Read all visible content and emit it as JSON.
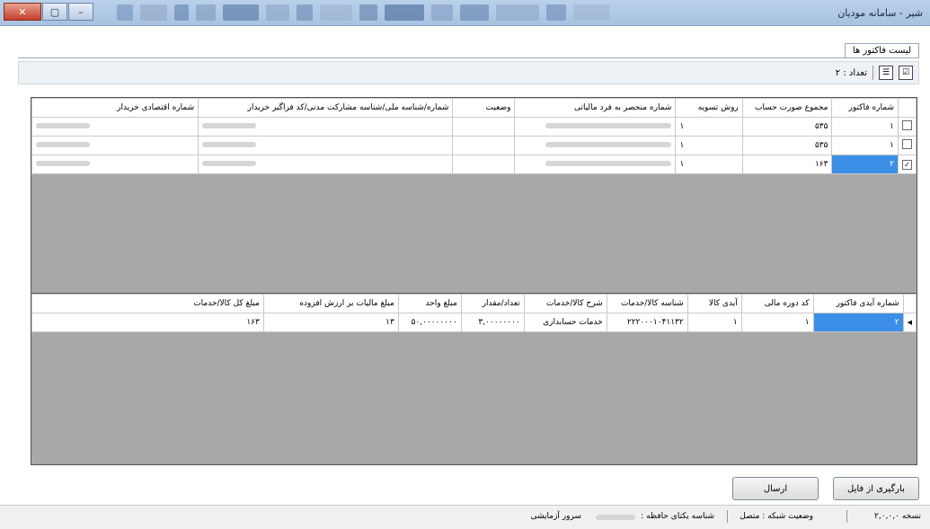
{
  "window": {
    "title": "شیر - سامانه مودیان"
  },
  "tabs": [
    {
      "label": "لیست فاکتور ها"
    }
  ],
  "filter": {
    "count_label": "تعداد : ۲"
  },
  "invoices": {
    "columns": [
      "شماره فاکتور",
      "مجموع صورت حساب",
      "روش تسویه",
      "شماره منحصر به فرد مالیاتی",
      "وضعیت",
      "شماره/شناسه ملی/شناسه مشارکت مدنی/کد فراگیر خریدار",
      "شماره اقتصادی خریدار"
    ],
    "rows": [
      {
        "checked": "",
        "number": "۱",
        "total": "۵۳۵",
        "settlement": "۱"
      },
      {
        "checked": "",
        "number": "۱",
        "total": "۵۳۵",
        "settlement": "۱"
      },
      {
        "checked": "✓",
        "number": "۲",
        "total": "۱۶۳",
        "settlement": "۱"
      }
    ]
  },
  "items": {
    "columns": [
      "شماره آیدی فاکتور",
      "کد دوره مالی",
      "آیدی کالا",
      "شناسه کالا/خدمات",
      "شرح کالا/خدمات",
      "تعداد/مقدار",
      "مبلغ واحد",
      "مبلغ مالیات بر ارزش افزوده",
      "مبلغ کل کالا/خدمات"
    ],
    "rows": [
      {
        "invoice_id": "۲",
        "period": "۱",
        "item_id": "۱",
        "service_code": "۲۲۲۰۰۰۱۰۴۱۱۳۲",
        "description": "خدمات حسابداری",
        "quantity": "۳,۰۰۰۰۰۰۰۰",
        "unit_price": "۵۰,۰۰۰۰۰۰۰۰",
        "vat": "۱۳",
        "total": "۱۶۳"
      }
    ]
  },
  "buttons": {
    "load_file": "بارگیری از فایل",
    "send": "ارسال"
  },
  "status": {
    "version": "نسخه ۲,۰,۰,۰",
    "network": "وضعیت شبکه : متصل",
    "memory_id": "شناسه یکتای حافظه :",
    "server": "سرور آزمایشی"
  },
  "colors": {
    "selection": "#3b8fe6",
    "grid_empty": "#a8a8a8"
  }
}
